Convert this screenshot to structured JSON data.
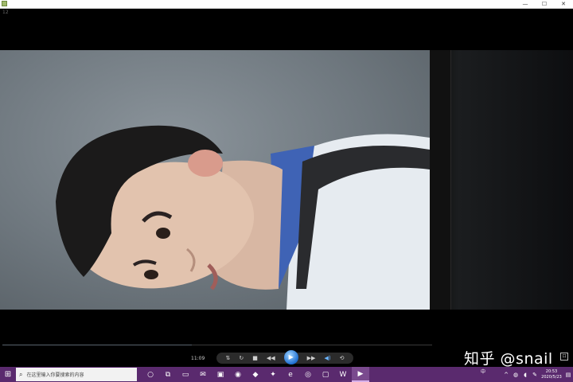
{
  "window": {
    "controls": {
      "minimize": "—",
      "maximize": "☐",
      "close": "✕"
    },
    "corner_tag": "12"
  },
  "player": {
    "time": "11:09",
    "progress_fraction": 0.44,
    "icons": [
      "repeat-icon",
      "refresh-icon",
      "stop-icon",
      "prev-icon",
      "play-icon",
      "next-icon",
      "volume-icon",
      "settings-icon"
    ]
  },
  "watermark": {
    "text": "知乎 @snail",
    "badge": "口"
  },
  "taskbar": {
    "search_placeholder": "在这里输入你要搜索的内容",
    "clock_time": "20:53",
    "clock_date": "2020/5/23",
    "ime": "中",
    "colors": {
      "taskbar": "#5a2a6e",
      "accent": "#1f6fd1"
    }
  }
}
